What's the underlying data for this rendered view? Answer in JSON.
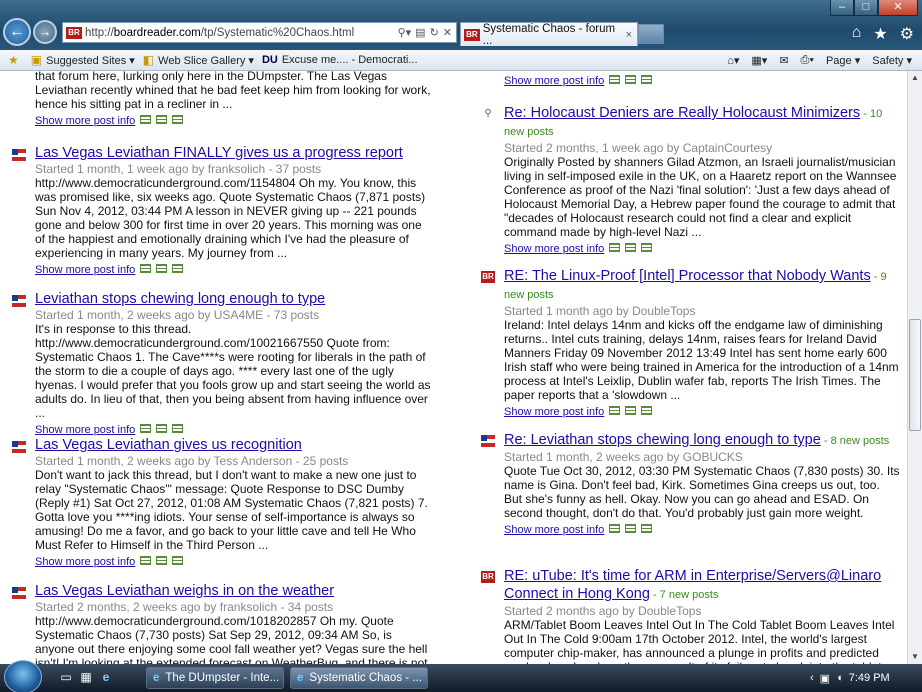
{
  "browser": {
    "url_prefix": "http://",
    "url_domain": "boardreader.com",
    "url_path": "/tp/Systematic%20Chaos.html",
    "tab_title": "Systematic Chaos - forum ...",
    "tab_close": "×",
    "favicon": "BR"
  },
  "favorites": {
    "items": [
      {
        "label": "Suggested Sites ▾"
      },
      {
        "label": "Web Slice Gallery ▾"
      },
      {
        "label": "Excuse me.... - Democrati..."
      }
    ],
    "excuse_prefix": "DU",
    "page_menu": "Page ▾",
    "safety_menu": "Safety ▾"
  },
  "left_posts": [
    {
      "title": "",
      "snippet": "that forum here, lurking only here in the DUmpster. The Las Vegas Leviathan recently whined that he bad feet keep him from looking for work, hence his sitting pat in a recliner in ...",
      "more": "Show more post info"
    },
    {
      "title": "Las Vegas Leviathan FINALLY gives us a progress report",
      "meta": "Started 1 month, 1 week ago  by franksolich - 37 posts",
      "snippet": "http://www.democraticunderground.com/1154804 Oh my. You know, this was promised like, six weeks ago. Quote Systematic Chaos (7,871 posts)  Sun Nov 4, 2012, 03:44 PM A lesson in NEVER giving up -- 221 pounds gone and below 300 for first time in over 20 years. This morning was one of the happiest and emotionally draining which I've had the pleasure of experiencing in many years. My journey from ...",
      "more": "Show more post info"
    },
    {
      "title": "Leviathan stops chewing long enough to type",
      "meta": "Started 1 month, 2 weeks ago  by USA4ME - 73 posts",
      "snippet": "It's in response to this thread. http://www.democraticunderground.com/10021667550 Quote from: Systematic Chaos 1. The Cave****s were rooting for liberals in the path of the storm to die a couple of days ago. **** every last one of the ugly hyenas. I would prefer that you fools grow up and start seeing the world as adults do.  In lieu of that, then you being absent from having influence over ...",
      "more": "Show more post info"
    },
    {
      "title": "Las Vegas Leviathan gives us recognition",
      "meta": "Started 1 month, 2 weeks ago  by Tess Anderson - 25 posts",
      "snippet": "Don't want to jack this thread, but I don't want to make a new one just to relay \"Systematic Chaos'\" message: Quote Response to DSC Dumby (Reply #1) Sat Oct 27, 2012, 01:08 AM Systematic Chaos (7,821 posts) 7. Gotta love you ****ing idiots. Your sense of self-importance is always so amusing! Do me a favor, and go back to your little cave and tell He Who Must Refer to Himself in the Third Person ...",
      "more": "Show more post info"
    },
    {
      "title": "Las Vegas Leviathan weighs in on the weather",
      "meta": "Started 2 months, 2 weeks ago  by franksolich - 34 posts",
      "snippet": "http://www.democraticunderground.com/1018202857 Oh my. Quote Systematic Chaos (7,730 posts)  Sat Sep 29, 2012, 09:34 AM So, is anyone out there enjoying some cool fall weather yet? Vegas sure the hell isn't! I'm looking at the extended forecast on WeatherBug, and there is not a day",
      "more": "Show more post info"
    }
  ],
  "right_posts": [
    {
      "title": "",
      "more": "Show more post info"
    },
    {
      "title": "Re: Holocaust Deniers are Really Holocaust Minimizers",
      "nposts": " - 10 new posts",
      "meta": "Started 2 months, 1 week ago  by CaptainCourtesy",
      "snippet": "Originally Posted by shanners Gilad Atzmon, an Israeli journalist/musician living in self-imposed exile in the UK, on a Haaretz report on the Wannsee Conference as proof of the Nazi 'final solution': 'Just a few days ahead of Holocaust Memorial Day, a Hebrew paper found the courage to admit that \"decades of Holocaust research could not find a clear and explicit command made by high-level Nazi ...",
      "more": "Show more post info"
    },
    {
      "title": "RE: The Linux-Proof [Intel] Processor that Nobody Wants",
      "nposts": " - 9 new posts",
      "meta": "Started 1 month ago  by DoubleTops",
      "snippet": "Ireland: Intel delays 14nm and kicks off the endgame law of diminishing returns.. Intel cuts training, delays 14nm, raises fears for Ireland David Manners Friday 09 November 2012 13:49 Intel has sent home early 600 Irish staff who were being trained in America for the introduction of a 14nm process at Intel's Leixlip, Dublin wafer fab, reports The Irish Times. The paper reports that a 'slowdown ...",
      "more": "Show more post info"
    },
    {
      "title": "Re: Leviathan stops chewing long enough to type",
      "nposts": " - 8 new posts",
      "meta": "Started 1 month, 2 weeks ago  by GOBUCKS",
      "snippet": "Quote Tue Oct 30, 2012, 03:30 PM Systematic Chaos (7,830 posts) 30. Its name is Gina. Don't feel bad, Kirk. Sometimes Gina creeps us out, too. But she's funny as hell. Okay. Now you can go ahead and ESAD. On second thought, don't do that. You'd probably just gain more weight.",
      "more": "Show more post info"
    },
    {
      "title": "RE: uTube: It's time for ARM in Enterprise/Servers@Linaro Connect in Hong Kong",
      "nposts": " - 7 new posts",
      "meta": "Started 2 months ago  by DoubleTops",
      "snippet": "ARM/Tablet Boom Leaves Intel Out In The Cold Tablet Boom Leaves Intel Out In The Cold 9:00am 17th October 2012. Intel, the world's largest computer chip-maker, has announced a plunge in profits and predicted weak sales ahead, partly as a result of its failure to break into the tablet"
    }
  ],
  "taskbar": {
    "task1": "The DUmpster - Inte...",
    "task2": "Systematic Chaos - ...",
    "time": "7:49 PM"
  }
}
